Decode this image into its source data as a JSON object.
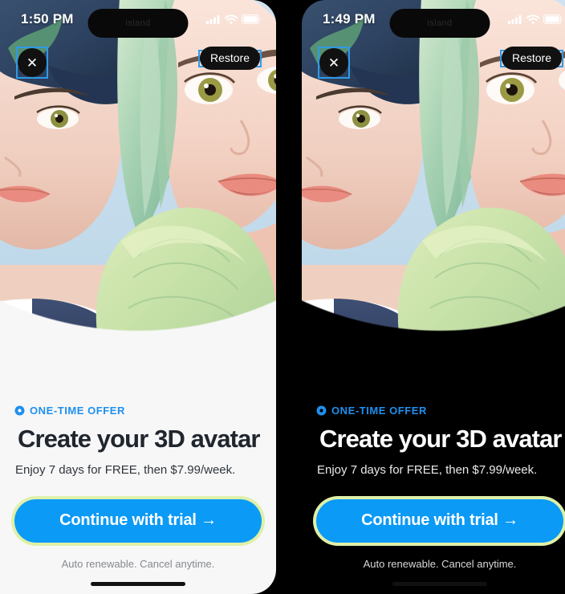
{
  "app": {
    "screen_name": "3D avatar paywall",
    "accent_blue": "#0b9af5",
    "offer_blue": "#1e90ef",
    "glow_ring": "#dff0a8",
    "light_bg": "#f7f7f7",
    "dark_bg": "#000000"
  },
  "panels": [
    {
      "id": "light",
      "theme": "light",
      "status_bar": {
        "time": "1:50 PM",
        "island_label": "island",
        "signal_icon": "cellular-signal-icon",
        "wifi_icon": "wifi-icon",
        "battery_icon": "battery-icon"
      },
      "controls": {
        "close_label": "✕",
        "close_icon": "close-icon",
        "restore_label": "Restore"
      },
      "offer": {
        "icon": "clock-badge-icon",
        "label": "ONE-TIME OFFER"
      },
      "headline": "Create your 3D avatar",
      "subline": "Enjoy 7 days for FREE, then $7.99/week.",
      "cta_label": "Continue with trial →",
      "fineprint": "Auto renewable. Cancel anytime."
    },
    {
      "id": "dark",
      "theme": "dark",
      "status_bar": {
        "time": "1:49 PM",
        "island_label": "island",
        "signal_icon": "cellular-signal-icon",
        "wifi_icon": "wifi-icon",
        "battery_icon": "battery-icon"
      },
      "controls": {
        "close_label": "✕",
        "close_icon": "close-icon",
        "restore_label": "Restore"
      },
      "offer": {
        "icon": "clock-badge-icon",
        "label": "ONE-TIME OFFER"
      },
      "headline": "Create your 3D avatar",
      "subline": "Enjoy 7 days for FREE, then $7.99/week.",
      "cta_label": "Continue with trial →",
      "fineprint": "Auto renewable. Cancel anytime."
    }
  ]
}
